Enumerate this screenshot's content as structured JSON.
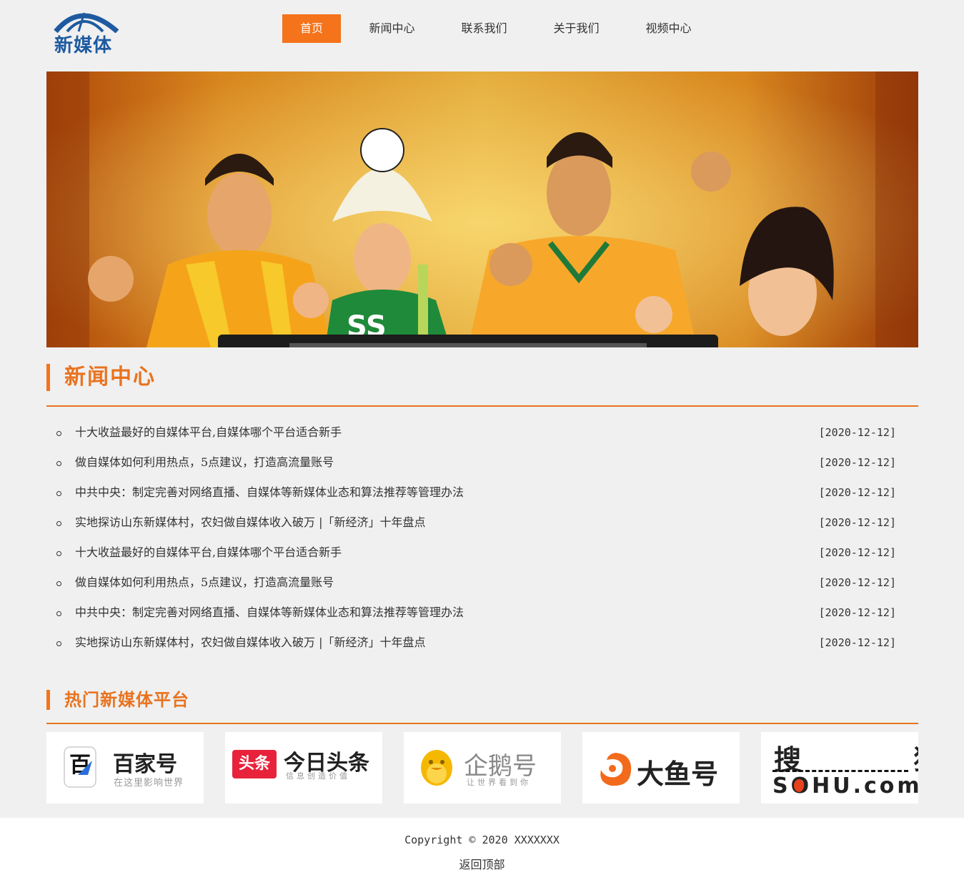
{
  "brand": {
    "logo_text": "新媒体"
  },
  "nav": {
    "items": [
      {
        "label": "首页"
      },
      {
        "label": "新闻中心"
      },
      {
        "label": "联系我们"
      },
      {
        "label": "关于我们"
      },
      {
        "label": "视频中心"
      }
    ],
    "active": "首页"
  },
  "colors": {
    "accent": "#f5731b",
    "title": "#e8731f",
    "logo": "#1e5aa0"
  },
  "news": {
    "title": "新闻中心",
    "items": [
      {
        "text": "十大收益最好的自媒体平台,自媒体哪个平台适合新手",
        "date": "[2020-12-12]"
      },
      {
        "text": "做自媒体如何利用热点，5点建议，打造高流量账号",
        "date": "[2020-12-12]"
      },
      {
        "text": "中共中央：制定完善对网络直播、自媒体等新媒体业态和算法推荐等管理办法",
        "date": "[2020-12-12]"
      },
      {
        "text": "实地探访山东新媒体村，农妇做自媒体收入破万 |「新经济」十年盘点",
        "date": "[2020-12-12]"
      },
      {
        "text": "十大收益最好的自媒体平台,自媒体哪个平台适合新手",
        "date": "[2020-12-12]"
      },
      {
        "text": "做自媒体如何利用热点，5点建议，打造高流量账号",
        "date": "[2020-12-12]"
      },
      {
        "text": "中共中央：制定完善对网络直播、自媒体等新媒体业态和算法推荐等管理办法",
        "date": "[2020-12-12]"
      },
      {
        "text": "实地探访山东新媒体村，农妇做自媒体收入破万 |「新经济」十年盘点",
        "date": "[2020-12-12]"
      }
    ]
  },
  "platforms": {
    "title": "热门新媒体平台",
    "items": [
      {
        "name": "百家号",
        "sub": "在这里影响世界",
        "icon": "baijiahao-icon"
      },
      {
        "name": "今日头条",
        "sub": "信息创造价值",
        "badge": "头条",
        "icon": "toutiao-icon"
      },
      {
        "name": "企鹅号",
        "sub": "让世界看到你",
        "icon": "penguin-icon"
      },
      {
        "name": "大鱼号",
        "icon": "fish-icon"
      },
      {
        "name": "搜 狐",
        "sub": "SOHU.com",
        "icon": "sohu-icon"
      }
    ]
  },
  "footer": {
    "copyright": "Copyright © 2020 XXXXXXX",
    "back_to_top": "返回顶部"
  }
}
